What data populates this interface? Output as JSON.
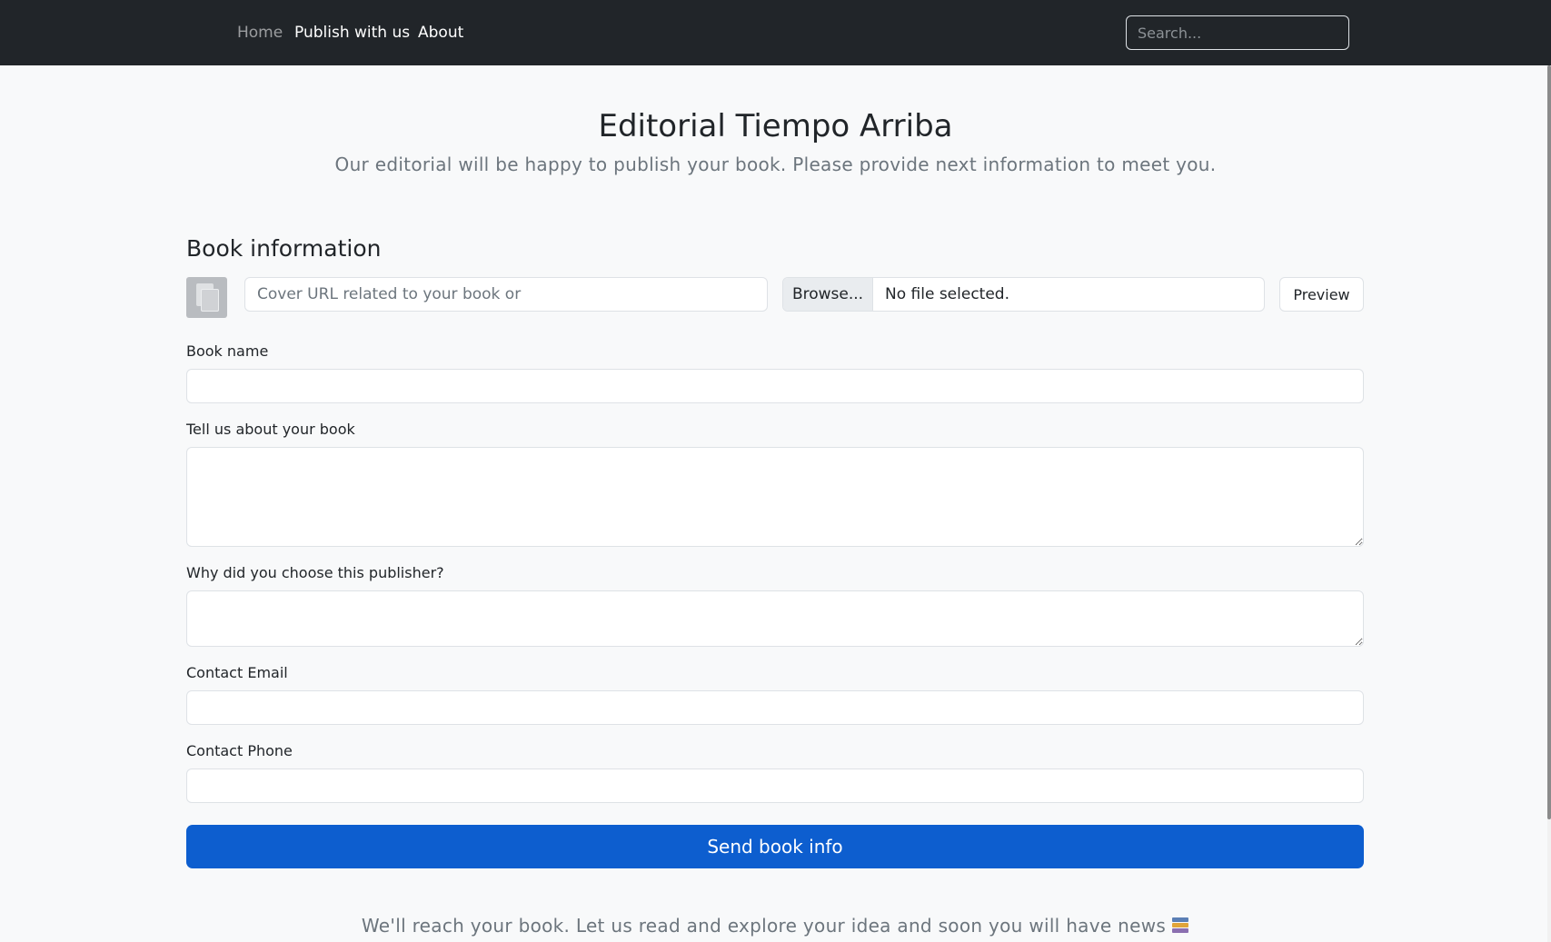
{
  "nav": {
    "items": [
      {
        "label": "Home"
      },
      {
        "label": "Publish with us"
      },
      {
        "label": "About"
      }
    ],
    "search_placeholder": "Search..."
  },
  "hero": {
    "title": "Editorial Tiempo Arriba",
    "subtitle": "Our editorial will be happy to publish your book. Please provide next information to meet you."
  },
  "form": {
    "section_title": "Book information",
    "cover_url": {
      "placeholder": "Cover URL related to your book or",
      "value": ""
    },
    "file_input": {
      "browse_label": "Browse...",
      "status": "No file selected."
    },
    "preview_label": "Preview",
    "book_name": {
      "label": "Book name",
      "value": ""
    },
    "about_book": {
      "label": "Tell us about your book",
      "value": ""
    },
    "why_publisher": {
      "label": "Why did you choose this publisher?",
      "value": ""
    },
    "contact_email": {
      "label": "Contact Email",
      "value": ""
    },
    "contact_phone": {
      "label": "Contact Phone",
      "value": ""
    },
    "submit_label": "Send book info"
  },
  "footer": {
    "text": "We'll reach your book. Let us read and explore your idea and soon you will have news",
    "icon": "books-icon"
  },
  "colors": {
    "navbar_bg": "#212529",
    "page_bg": "#f8f9fa",
    "primary_button": "#0d5ecf",
    "muted_text": "#6c757d"
  }
}
